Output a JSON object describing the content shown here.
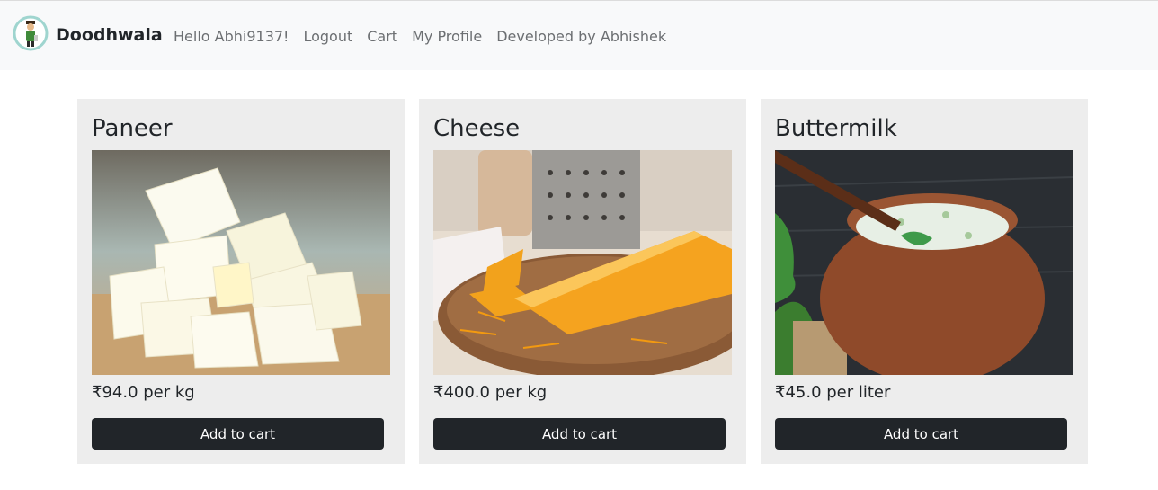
{
  "navbar": {
    "brand": "Doodhwala",
    "links": [
      {
        "label": "Hello Abhi9137!"
      },
      {
        "label": "Logout"
      },
      {
        "label": "Cart"
      },
      {
        "label": "My Profile"
      },
      {
        "label": "Developed by Abhishek"
      }
    ]
  },
  "products": [
    {
      "name": "Paneer",
      "price": "₹94.0 per kg",
      "button": "Add to cart",
      "image": "paneer-image"
    },
    {
      "name": "Cheese",
      "price": "₹400.0 per kg",
      "button": "Add to cart",
      "image": "cheese-image"
    },
    {
      "name": "Buttermilk",
      "price": "₹45.0 per liter",
      "button": "Add to cart",
      "image": "buttermilk-image"
    }
  ],
  "colors": {
    "navbar_bg": "#f8f9fa",
    "card_bg": "#ededed",
    "button_bg": "#212529",
    "nav_link": "#6c6f72"
  }
}
